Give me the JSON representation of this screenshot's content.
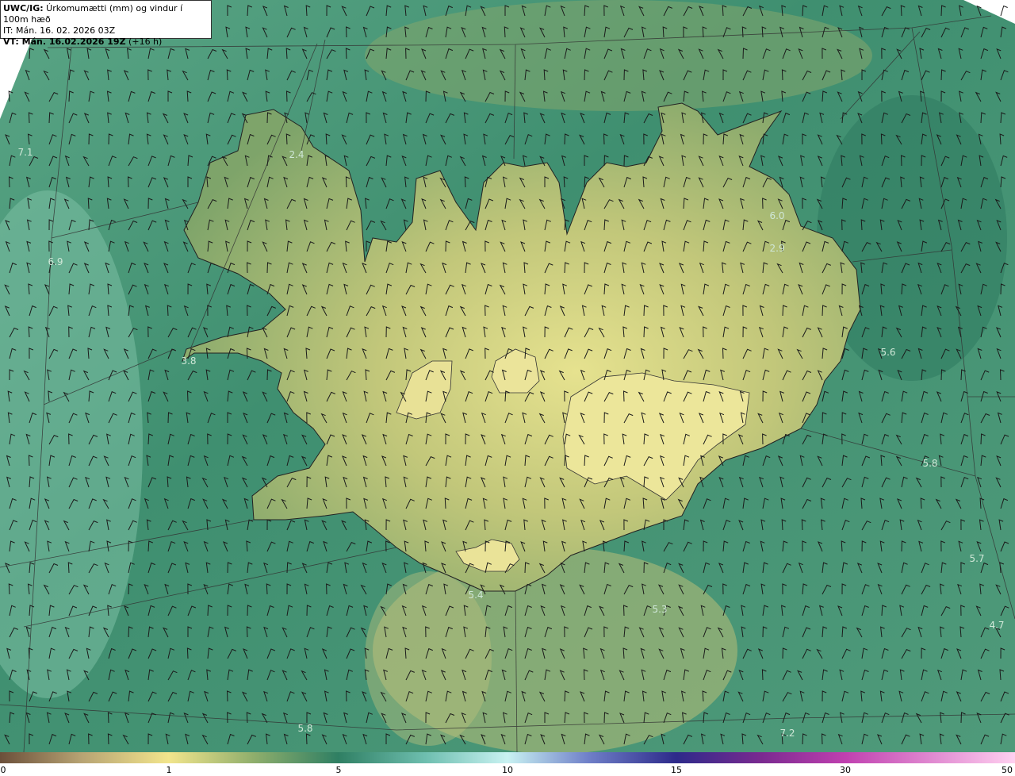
{
  "header": {
    "title_prefix": "UWC/IG:",
    "title_text": " Úrkomumætti (mm) og vindur í 100m hæð",
    "init_time": "IT: Mán. 16. 02. 2026 03Z",
    "valid_prefix": "VT: Mán. 16.02.2026 19Z",
    "valid_suffix": " (+16 h)"
  },
  "point_labels": [
    {
      "id": "v71",
      "text": "7.1"
    },
    {
      "id": "v69",
      "text": "6.9"
    },
    {
      "id": "v38",
      "text": "3.8"
    },
    {
      "id": "v24",
      "text": "2.4"
    },
    {
      "id": "v60",
      "text": "6.0"
    },
    {
      "id": "v29",
      "text": "2.9"
    },
    {
      "id": "v56",
      "text": "5.6"
    },
    {
      "id": "v58e",
      "text": "5.8"
    },
    {
      "id": "v57",
      "text": "5.7"
    },
    {
      "id": "v47",
      "text": "4.7"
    },
    {
      "id": "v53",
      "text": "5.3"
    },
    {
      "id": "v54",
      "text": "5.4"
    },
    {
      "id": "v58s",
      "text": "5.8"
    },
    {
      "id": "v72",
      "text": "7.2"
    }
  ],
  "colorbar": {
    "ticks": [
      "0",
      "1",
      "5",
      "10",
      "15",
      "30",
      "50"
    ],
    "colors": [
      "#6b4f3a",
      "#f2e58c",
      "#2f7f63",
      "#c9f2f2",
      "#2d2a8a",
      "#9b2a8f",
      "#ffd0f0"
    ]
  },
  "palette": {
    "sea_dark": "#2a7a62",
    "sea_light": "#7fbfaa",
    "land_high": "#e2e08e",
    "land_mid": "#a9b86a",
    "land_low": "#5e9a68"
  }
}
